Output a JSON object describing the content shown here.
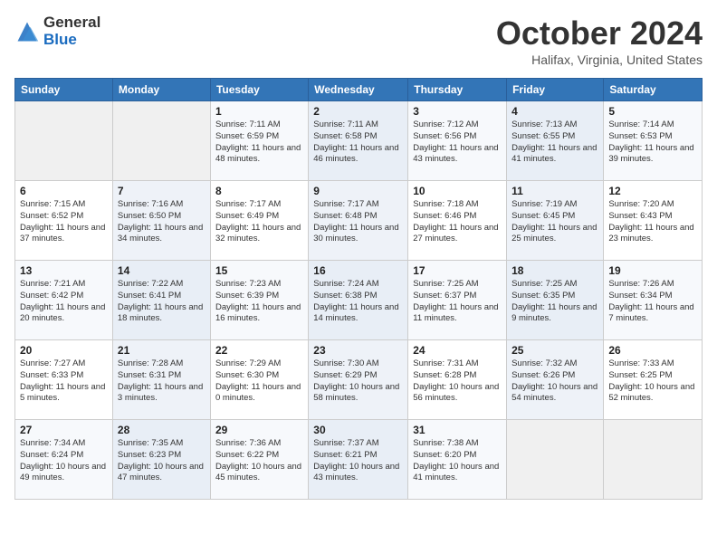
{
  "logo": {
    "general": "General",
    "blue": "Blue"
  },
  "title": "October 2024",
  "location": "Halifax, Virginia, United States",
  "days_of_week": [
    "Sunday",
    "Monday",
    "Tuesday",
    "Wednesday",
    "Thursday",
    "Friday",
    "Saturday"
  ],
  "weeks": [
    [
      {
        "day": "",
        "info": ""
      },
      {
        "day": "",
        "info": ""
      },
      {
        "day": "1",
        "info": "Sunrise: 7:11 AM\nSunset: 6:59 PM\nDaylight: 11 hours and 48 minutes."
      },
      {
        "day": "2",
        "info": "Sunrise: 7:11 AM\nSunset: 6:58 PM\nDaylight: 11 hours and 46 minutes."
      },
      {
        "day": "3",
        "info": "Sunrise: 7:12 AM\nSunset: 6:56 PM\nDaylight: 11 hours and 43 minutes."
      },
      {
        "day": "4",
        "info": "Sunrise: 7:13 AM\nSunset: 6:55 PM\nDaylight: 11 hours and 41 minutes."
      },
      {
        "day": "5",
        "info": "Sunrise: 7:14 AM\nSunset: 6:53 PM\nDaylight: 11 hours and 39 minutes."
      }
    ],
    [
      {
        "day": "6",
        "info": "Sunrise: 7:15 AM\nSunset: 6:52 PM\nDaylight: 11 hours and 37 minutes."
      },
      {
        "day": "7",
        "info": "Sunrise: 7:16 AM\nSunset: 6:50 PM\nDaylight: 11 hours and 34 minutes."
      },
      {
        "day": "8",
        "info": "Sunrise: 7:17 AM\nSunset: 6:49 PM\nDaylight: 11 hours and 32 minutes."
      },
      {
        "day": "9",
        "info": "Sunrise: 7:17 AM\nSunset: 6:48 PM\nDaylight: 11 hours and 30 minutes."
      },
      {
        "day": "10",
        "info": "Sunrise: 7:18 AM\nSunset: 6:46 PM\nDaylight: 11 hours and 27 minutes."
      },
      {
        "day": "11",
        "info": "Sunrise: 7:19 AM\nSunset: 6:45 PM\nDaylight: 11 hours and 25 minutes."
      },
      {
        "day": "12",
        "info": "Sunrise: 7:20 AM\nSunset: 6:43 PM\nDaylight: 11 hours and 23 minutes."
      }
    ],
    [
      {
        "day": "13",
        "info": "Sunrise: 7:21 AM\nSunset: 6:42 PM\nDaylight: 11 hours and 20 minutes."
      },
      {
        "day": "14",
        "info": "Sunrise: 7:22 AM\nSunset: 6:41 PM\nDaylight: 11 hours and 18 minutes."
      },
      {
        "day": "15",
        "info": "Sunrise: 7:23 AM\nSunset: 6:39 PM\nDaylight: 11 hours and 16 minutes."
      },
      {
        "day": "16",
        "info": "Sunrise: 7:24 AM\nSunset: 6:38 PM\nDaylight: 11 hours and 14 minutes."
      },
      {
        "day": "17",
        "info": "Sunrise: 7:25 AM\nSunset: 6:37 PM\nDaylight: 11 hours and 11 minutes."
      },
      {
        "day": "18",
        "info": "Sunrise: 7:25 AM\nSunset: 6:35 PM\nDaylight: 11 hours and 9 minutes."
      },
      {
        "day": "19",
        "info": "Sunrise: 7:26 AM\nSunset: 6:34 PM\nDaylight: 11 hours and 7 minutes."
      }
    ],
    [
      {
        "day": "20",
        "info": "Sunrise: 7:27 AM\nSunset: 6:33 PM\nDaylight: 11 hours and 5 minutes."
      },
      {
        "day": "21",
        "info": "Sunrise: 7:28 AM\nSunset: 6:31 PM\nDaylight: 11 hours and 3 minutes."
      },
      {
        "day": "22",
        "info": "Sunrise: 7:29 AM\nSunset: 6:30 PM\nDaylight: 11 hours and 0 minutes."
      },
      {
        "day": "23",
        "info": "Sunrise: 7:30 AM\nSunset: 6:29 PM\nDaylight: 10 hours and 58 minutes."
      },
      {
        "day": "24",
        "info": "Sunrise: 7:31 AM\nSunset: 6:28 PM\nDaylight: 10 hours and 56 minutes."
      },
      {
        "day": "25",
        "info": "Sunrise: 7:32 AM\nSunset: 6:26 PM\nDaylight: 10 hours and 54 minutes."
      },
      {
        "day": "26",
        "info": "Sunrise: 7:33 AM\nSunset: 6:25 PM\nDaylight: 10 hours and 52 minutes."
      }
    ],
    [
      {
        "day": "27",
        "info": "Sunrise: 7:34 AM\nSunset: 6:24 PM\nDaylight: 10 hours and 49 minutes."
      },
      {
        "day": "28",
        "info": "Sunrise: 7:35 AM\nSunset: 6:23 PM\nDaylight: 10 hours and 47 minutes."
      },
      {
        "day": "29",
        "info": "Sunrise: 7:36 AM\nSunset: 6:22 PM\nDaylight: 10 hours and 45 minutes."
      },
      {
        "day": "30",
        "info": "Sunrise: 7:37 AM\nSunset: 6:21 PM\nDaylight: 10 hours and 43 minutes."
      },
      {
        "day": "31",
        "info": "Sunrise: 7:38 AM\nSunset: 6:20 PM\nDaylight: 10 hours and 41 minutes."
      },
      {
        "day": "",
        "info": ""
      },
      {
        "day": "",
        "info": ""
      }
    ]
  ]
}
